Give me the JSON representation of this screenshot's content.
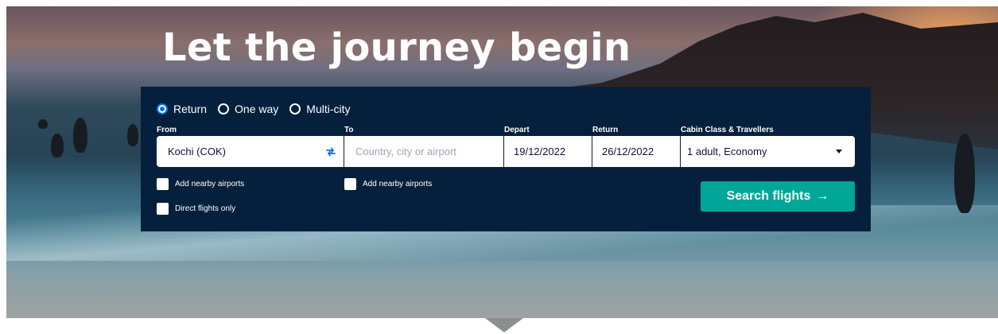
{
  "hero": {
    "title": "Let the journey begin"
  },
  "search": {
    "trip_types": [
      {
        "label": "Return",
        "selected": true
      },
      {
        "label": "One way",
        "selected": false
      },
      {
        "label": "Multi-city",
        "selected": false
      }
    ],
    "from": {
      "label": "From",
      "value": "Kochi (COK)"
    },
    "to": {
      "label": "To",
      "placeholder": "Country, city or airport"
    },
    "depart": {
      "label": "Depart",
      "value": "19/12/2022"
    },
    "return": {
      "label": "Return",
      "value": "26/12/2022"
    },
    "cabin": {
      "label": "Cabin Class & Travellers",
      "value": "1 adult, Economy"
    },
    "checkboxes": {
      "nearby_from": "Add nearby airports",
      "nearby_to": "Add nearby airports",
      "direct": "Direct flights only"
    },
    "button_label": "Search flights",
    "button_arrow": "→"
  },
  "colors": {
    "panel": "#05203c",
    "button": "#00a698",
    "radio_selected": "#0770e3",
    "swap_icon": "#0770e3"
  },
  "icons": [
    "swap-arrows-icon",
    "dropdown-caret-icon",
    "arrow-right-icon"
  ]
}
